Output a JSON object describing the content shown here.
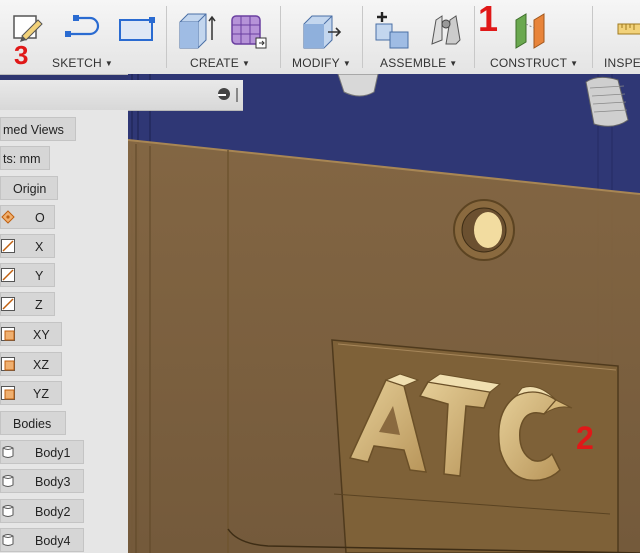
{
  "toolbar": {
    "groups": {
      "sketch": "SKETCH",
      "create": "CREATE",
      "modify": "MODIFY",
      "assemble": "ASSEMBLE",
      "construct": "CONSTRUCT",
      "inspect": "INSPE"
    }
  },
  "annotations": {
    "a1": "1",
    "a2": "2",
    "a3": "3"
  },
  "browser": {
    "named_views": "med Views",
    "units": "ts: mm",
    "origin": "Origin",
    "origin_items": [
      "O",
      "X",
      "Y",
      "Z",
      "XY",
      "XZ",
      "YZ"
    ],
    "bodies": "Bodies",
    "body_items": [
      "Body1",
      "Body3",
      "Body2",
      "Body4"
    ]
  },
  "model": {
    "engraved_text": "ATC"
  },
  "colors": {
    "accent_blue": "#2a6bd1",
    "annotation_red": "#e01818",
    "part_tan": "#b8955a",
    "viewport_bg": "#343c80"
  }
}
